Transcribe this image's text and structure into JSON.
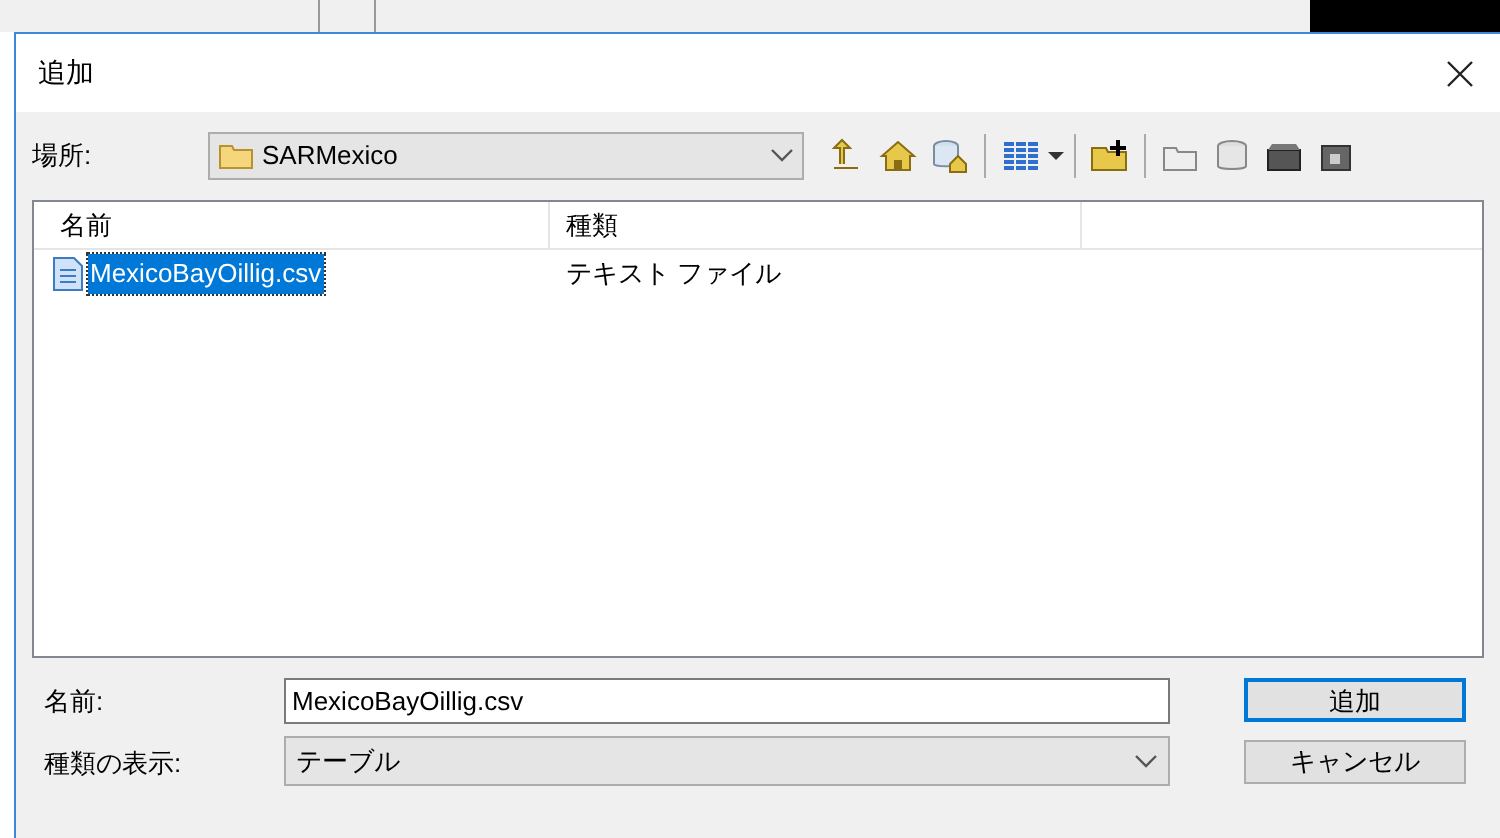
{
  "window": {
    "title": "追加"
  },
  "location": {
    "label": "場所:",
    "value": "SARMexico"
  },
  "list": {
    "columns": [
      "名前",
      "種類"
    ],
    "rows": [
      {
        "name": "MexicoBayOillig.csv",
        "type": "テキスト ファイル",
        "selected": true
      }
    ]
  },
  "name_field": {
    "label": "名前:",
    "value": "MexicoBayOillig.csv"
  },
  "type_field": {
    "label": "種類の表示:",
    "value": "テーブル"
  },
  "buttons": [
    {
      "label": "追加",
      "default": true
    },
    {
      "label": "キャンセル",
      "default": false
    }
  ]
}
